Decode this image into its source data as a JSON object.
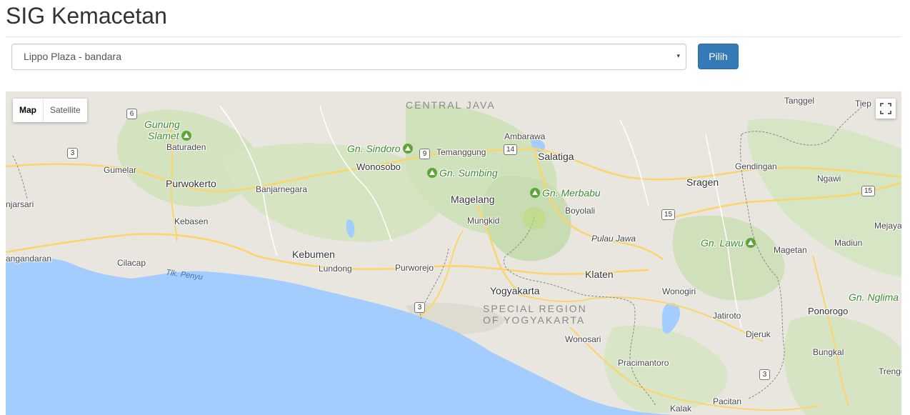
{
  "header": {
    "title": "SIG Kemacetan"
  },
  "route_select": {
    "value": "Lippo Plaza - bandara",
    "caret": "▾"
  },
  "buttons": {
    "pilih": "Pilih"
  },
  "map": {
    "type_controls": {
      "map": "Map",
      "satellite": "Satellite"
    },
    "regions": {
      "central_java": "CENTRAL JAVA",
      "special_region_1": "SPECIAL REGION",
      "special_region_2": "OF YOGYAKARTA"
    },
    "mountains": {
      "slamet_1": "Gunung",
      "slamet_2": "Slamet",
      "sindoro": "Gn. Sindoro",
      "sumbing": "Gn. Sumbing",
      "merbabu": "Gn. Merbabu",
      "lawu": "Gn. Lawu",
      "nglima": "Gn. Nglima"
    },
    "water": {
      "penyu": "Tlk. Penyu",
      "pulau_jawa": "Pulau Jawa"
    },
    "cities": {
      "purwokerto": "Purwokerto",
      "kebumen": "Kebumen",
      "magelang": "Magelang",
      "salatiga": "Salatiga",
      "yogyakarta": "Yogyakarta",
      "klaten": "Klaten",
      "sragen": "Sragen",
      "wonosobo": "Wonosobo",
      "ponorogo": "Ponorogo"
    },
    "towns": {
      "baturaden": "Baturaden",
      "gumelar": "Gumelar",
      "banjarnegara": "Banjarnegara",
      "kebasen": "Kebasen",
      "cilacap": "Cilacap",
      "ngandaran": "angandaran",
      "jarsari": "njarsari",
      "lundong": "Lundong",
      "purworejo": "Purworejo",
      "mungkid": "Mungkid",
      "temanggung": "Temanggung",
      "ambarawa": "Ambarawa",
      "boyolali": "Boyolali",
      "wonogiri": "Wonogiri",
      "jatiroto": "Jatiroto",
      "djeruk": "Djeruk",
      "wonosari": "Wonosari",
      "pracimantoro": "Pracimantoro",
      "pacitan": "Pacitan",
      "kalak": "Kalak",
      "bungkal": "Bungkal",
      "magetan": "Magetan",
      "madiun": "Madiun",
      "ngawi": "Ngawi",
      "gendingan": "Gendingan",
      "tanggel": "Tanggel",
      "tiep": "Tiep",
      "mejaya": "Mejaya",
      "trenggalek": "Trengg"
    },
    "shields": {
      "s6": "6",
      "s3a": "3",
      "s9": "9",
      "s14": "14",
      "s15a": "15",
      "s15b": "15",
      "s3b": "3",
      "s3c": "3"
    },
    "colors": {
      "sea": "#a3ccff",
      "land": "#e8e6df",
      "forest": "#cfe0bb",
      "road": "#fbd56b"
    }
  }
}
